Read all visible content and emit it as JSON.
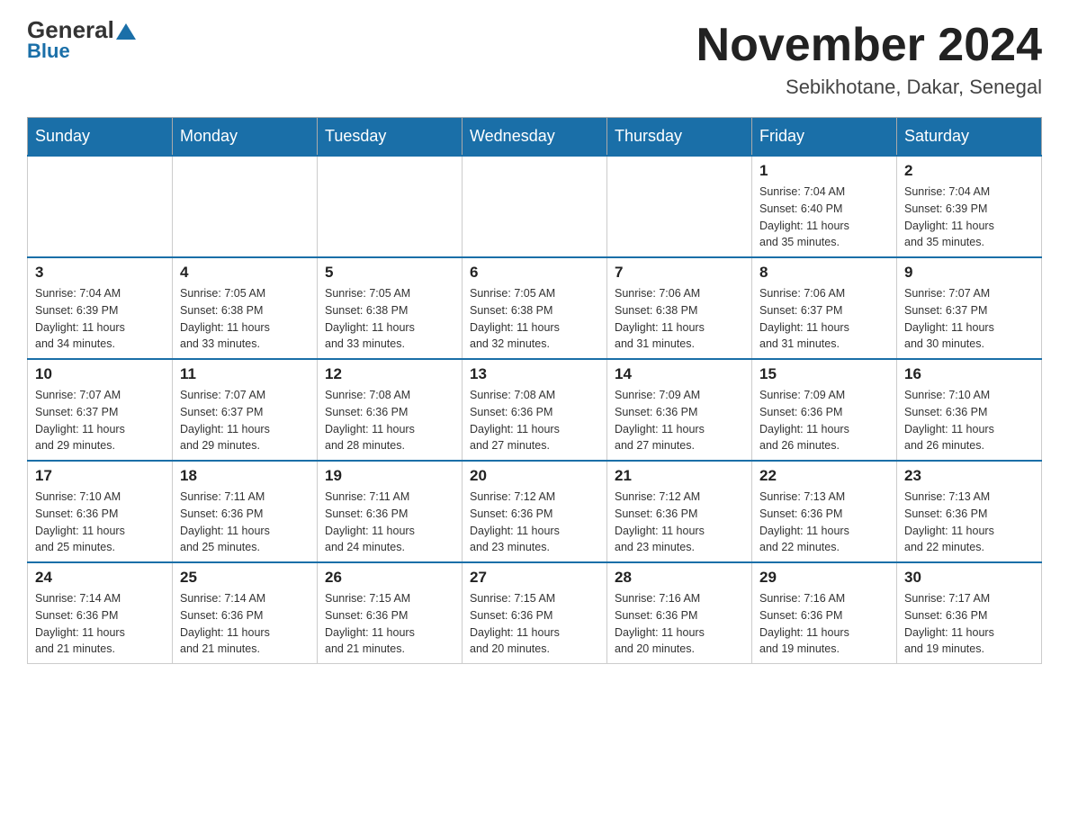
{
  "header": {
    "logo_general": "General",
    "logo_blue": "Blue",
    "title": "November 2024",
    "subtitle": "Sebikhotane, Dakar, Senegal"
  },
  "days_of_week": [
    "Sunday",
    "Monday",
    "Tuesday",
    "Wednesday",
    "Thursday",
    "Friday",
    "Saturday"
  ],
  "weeks": [
    [
      {
        "day": "",
        "info": ""
      },
      {
        "day": "",
        "info": ""
      },
      {
        "day": "",
        "info": ""
      },
      {
        "day": "",
        "info": ""
      },
      {
        "day": "",
        "info": ""
      },
      {
        "day": "1",
        "info": "Sunrise: 7:04 AM\nSunset: 6:40 PM\nDaylight: 11 hours\nand 35 minutes."
      },
      {
        "day": "2",
        "info": "Sunrise: 7:04 AM\nSunset: 6:39 PM\nDaylight: 11 hours\nand 35 minutes."
      }
    ],
    [
      {
        "day": "3",
        "info": "Sunrise: 7:04 AM\nSunset: 6:39 PM\nDaylight: 11 hours\nand 34 minutes."
      },
      {
        "day": "4",
        "info": "Sunrise: 7:05 AM\nSunset: 6:38 PM\nDaylight: 11 hours\nand 33 minutes."
      },
      {
        "day": "5",
        "info": "Sunrise: 7:05 AM\nSunset: 6:38 PM\nDaylight: 11 hours\nand 33 minutes."
      },
      {
        "day": "6",
        "info": "Sunrise: 7:05 AM\nSunset: 6:38 PM\nDaylight: 11 hours\nand 32 minutes."
      },
      {
        "day": "7",
        "info": "Sunrise: 7:06 AM\nSunset: 6:38 PM\nDaylight: 11 hours\nand 31 minutes."
      },
      {
        "day": "8",
        "info": "Sunrise: 7:06 AM\nSunset: 6:37 PM\nDaylight: 11 hours\nand 31 minutes."
      },
      {
        "day": "9",
        "info": "Sunrise: 7:07 AM\nSunset: 6:37 PM\nDaylight: 11 hours\nand 30 minutes."
      }
    ],
    [
      {
        "day": "10",
        "info": "Sunrise: 7:07 AM\nSunset: 6:37 PM\nDaylight: 11 hours\nand 29 minutes."
      },
      {
        "day": "11",
        "info": "Sunrise: 7:07 AM\nSunset: 6:37 PM\nDaylight: 11 hours\nand 29 minutes."
      },
      {
        "day": "12",
        "info": "Sunrise: 7:08 AM\nSunset: 6:36 PM\nDaylight: 11 hours\nand 28 minutes."
      },
      {
        "day": "13",
        "info": "Sunrise: 7:08 AM\nSunset: 6:36 PM\nDaylight: 11 hours\nand 27 minutes."
      },
      {
        "day": "14",
        "info": "Sunrise: 7:09 AM\nSunset: 6:36 PM\nDaylight: 11 hours\nand 27 minutes."
      },
      {
        "day": "15",
        "info": "Sunrise: 7:09 AM\nSunset: 6:36 PM\nDaylight: 11 hours\nand 26 minutes."
      },
      {
        "day": "16",
        "info": "Sunrise: 7:10 AM\nSunset: 6:36 PM\nDaylight: 11 hours\nand 26 minutes."
      }
    ],
    [
      {
        "day": "17",
        "info": "Sunrise: 7:10 AM\nSunset: 6:36 PM\nDaylight: 11 hours\nand 25 minutes."
      },
      {
        "day": "18",
        "info": "Sunrise: 7:11 AM\nSunset: 6:36 PM\nDaylight: 11 hours\nand 25 minutes."
      },
      {
        "day": "19",
        "info": "Sunrise: 7:11 AM\nSunset: 6:36 PM\nDaylight: 11 hours\nand 24 minutes."
      },
      {
        "day": "20",
        "info": "Sunrise: 7:12 AM\nSunset: 6:36 PM\nDaylight: 11 hours\nand 23 minutes."
      },
      {
        "day": "21",
        "info": "Sunrise: 7:12 AM\nSunset: 6:36 PM\nDaylight: 11 hours\nand 23 minutes."
      },
      {
        "day": "22",
        "info": "Sunrise: 7:13 AM\nSunset: 6:36 PM\nDaylight: 11 hours\nand 22 minutes."
      },
      {
        "day": "23",
        "info": "Sunrise: 7:13 AM\nSunset: 6:36 PM\nDaylight: 11 hours\nand 22 minutes."
      }
    ],
    [
      {
        "day": "24",
        "info": "Sunrise: 7:14 AM\nSunset: 6:36 PM\nDaylight: 11 hours\nand 21 minutes."
      },
      {
        "day": "25",
        "info": "Sunrise: 7:14 AM\nSunset: 6:36 PM\nDaylight: 11 hours\nand 21 minutes."
      },
      {
        "day": "26",
        "info": "Sunrise: 7:15 AM\nSunset: 6:36 PM\nDaylight: 11 hours\nand 21 minutes."
      },
      {
        "day": "27",
        "info": "Sunrise: 7:15 AM\nSunset: 6:36 PM\nDaylight: 11 hours\nand 20 minutes."
      },
      {
        "day": "28",
        "info": "Sunrise: 7:16 AM\nSunset: 6:36 PM\nDaylight: 11 hours\nand 20 minutes."
      },
      {
        "day": "29",
        "info": "Sunrise: 7:16 AM\nSunset: 6:36 PM\nDaylight: 11 hours\nand 19 minutes."
      },
      {
        "day": "30",
        "info": "Sunrise: 7:17 AM\nSunset: 6:36 PM\nDaylight: 11 hours\nand 19 minutes."
      }
    ]
  ]
}
